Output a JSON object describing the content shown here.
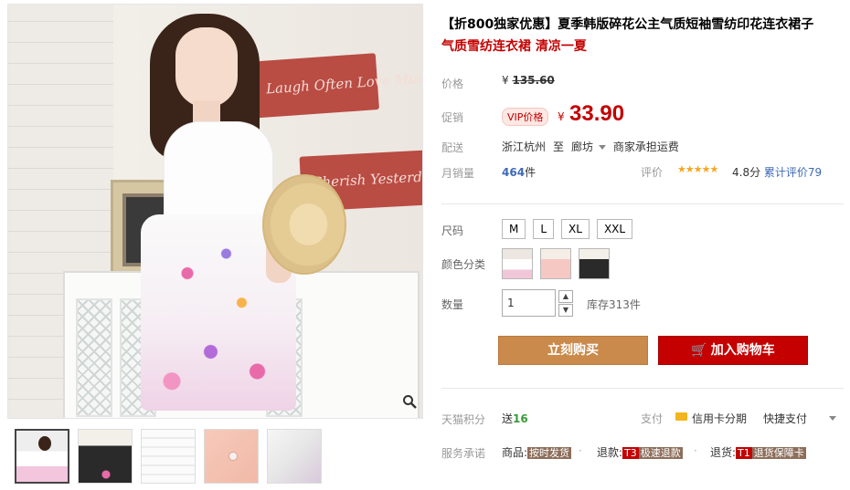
{
  "gallery": {
    "sign_top": "Laugh Often Love Much",
    "sign_bottom": "Cherish Yesterday Dream",
    "thumbnails": [
      "thumb-1",
      "thumb-2",
      "thumb-3",
      "thumb-4",
      "thumb-5"
    ]
  },
  "product": {
    "title": "【折800独家优惠】夏季韩版碎花公主气质短袖雪纺印花连衣裙子",
    "subtitle": "气质雪纺连衣裙 清凉一夏"
  },
  "price": {
    "label": "价格",
    "yen": "¥",
    "original": "135.60",
    "promo_label": "促销",
    "vip_badge": "VIP价格",
    "current": "33.90"
  },
  "shipping": {
    "label": "配送",
    "from": "浙江杭州",
    "to_word": "至",
    "to": "廊坊",
    "note": "商家承担运费"
  },
  "sales": {
    "label": "月销量",
    "count": "464",
    "unit": "件",
    "rating_label": "评价",
    "stars": "★★★★★",
    "score": "4.8分",
    "cumulative": "累计评价79"
  },
  "options": {
    "size_label": "尺码",
    "sizes": [
      "M",
      "L",
      "XL",
      "XXL"
    ],
    "color_label": "颜色分类",
    "quantity_label": "数量",
    "quantity": "1",
    "up": "▲",
    "down": "▼",
    "stock": "库存313件"
  },
  "actions": {
    "buy": "立刻购买",
    "cart_icon": "🛒",
    "cart": "加入购物车"
  },
  "extras": {
    "points_label": "天猫积分",
    "points_prefix": "送",
    "points": "16",
    "pay_label": "支付",
    "credit": "信用卡分期",
    "fast_pay": "快捷支付",
    "service_label": "服务承诺",
    "goods_prefix": "商品:",
    "goods_tag": "按时发货",
    "refund_prefix": "退款:",
    "refund_code": "T3",
    "refund_tag": "极速退款",
    "return_prefix": "退货:",
    "return_code": "T1",
    "return_tag": "退货保障卡",
    "sep": "·"
  },
  "colors": {
    "accent_red": "#c40000",
    "buy_orange": "#ca8a4b",
    "link_blue": "#3d6ab5"
  }
}
